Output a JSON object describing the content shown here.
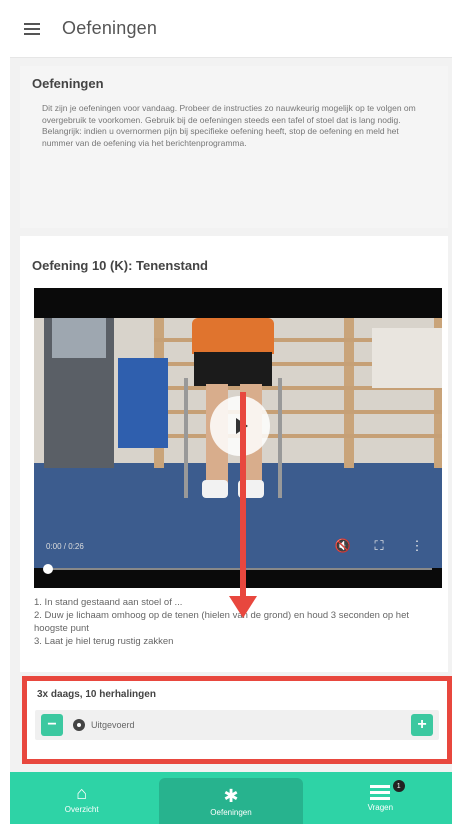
{
  "header": {
    "title": "Oefeningen",
    "corner_text": ""
  },
  "intro": {
    "title": "Oefeningen",
    "text": "Dit zijn je oefeningen voor vandaag. Probeer de instructies zo nauwkeurig mogelijk op te volgen om overgebruik te voorkomen. Gebruik bij de oefeningen steeds een tafel of stoel dat is lang nodig. Belangrijk: indien u overnormen pijn bij specifieke oefening heeft, stop de oefening en meld het nummer van de oefening via het berichtenprogramma."
  },
  "exercise": {
    "title": "Oefening 10 (K): Tenenstand",
    "video": {
      "time": "0:00 / 0:26",
      "progress": 0.0,
      "mute_icon": "mute-icon",
      "fullscreen_icon": "fullscreen-icon",
      "more_icon": "more-vertical-icon"
    },
    "instructions": [
      "1. In stand gestaand aan stoel of ...",
      "2. Duw je lichaam omhoog op de tenen (hielen van de grond) en houd 3 seconden op het hoogste punt",
      "3. Laat je hiel terug rustig zakken"
    ]
  },
  "dosage": {
    "title": "3x daags, 10 herhalingen",
    "status": "Uitgevoerd",
    "minus_label": "−",
    "plus_label": "+"
  },
  "nav": {
    "items": [
      {
        "label": "Overzicht",
        "icon": "home-icon"
      },
      {
        "label": "Oefeningen",
        "icon": "walking-icon"
      },
      {
        "label": "Vragen",
        "icon": "list-icon"
      }
    ],
    "badge": "1"
  },
  "colors": {
    "accent": "#2ed3a6",
    "annotation": "#e8473e"
  }
}
